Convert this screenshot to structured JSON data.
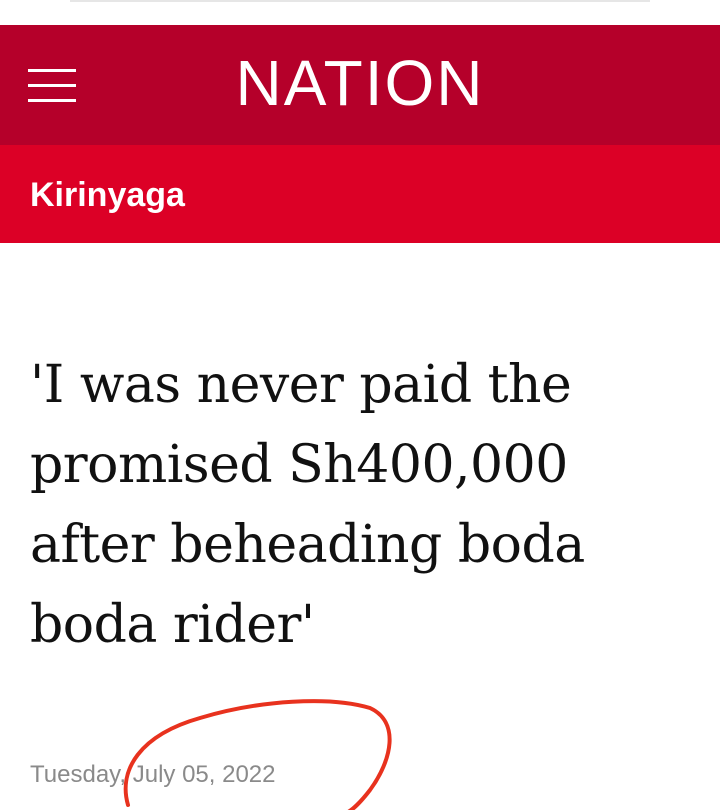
{
  "header": {
    "brand": "NATION",
    "menu_icon": "hamburger-menu-icon",
    "background_color": "#b5002a"
  },
  "section": {
    "label": "Kirinyaga",
    "background_color": "#dc0026"
  },
  "article": {
    "headline": "'I was never paid the promised Sh400,000 after beheading boda boda rider'",
    "date": "Tuesday, July 05, 2022"
  },
  "annotation": {
    "type": "hand-drawn-circle",
    "color": "#e8321e"
  }
}
